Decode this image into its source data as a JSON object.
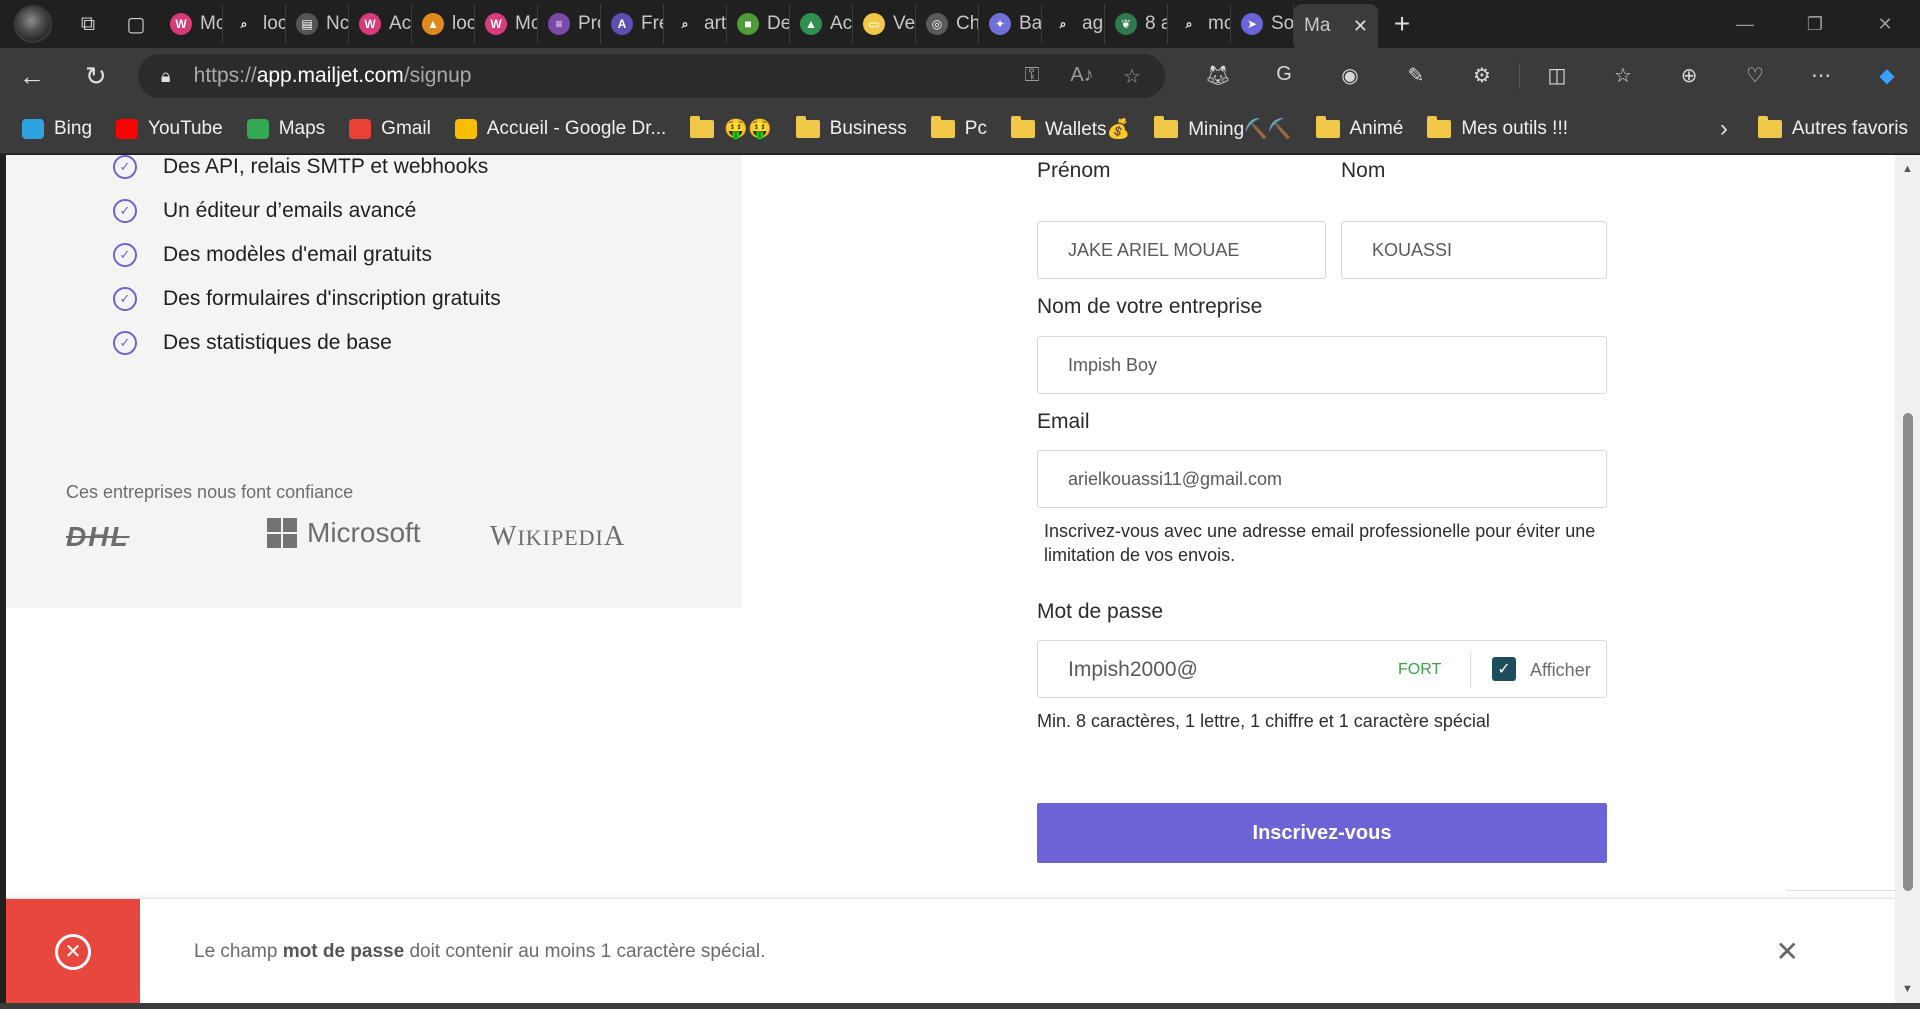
{
  "browser": {
    "tabs": [
      {
        "label": "Mc",
        "color": "#d83b7a",
        "glyph": "W"
      },
      {
        "label": "loc",
        "color": "#202020",
        "glyph": "⌕"
      },
      {
        "label": "Nc",
        "color": "#555555",
        "glyph": "▤"
      },
      {
        "label": "Ac",
        "color": "#d83b7a",
        "glyph": "W"
      },
      {
        "label": "loc",
        "color": "#e08a1e",
        "glyph": "▲"
      },
      {
        "label": "Mc",
        "color": "#d83b7a",
        "glyph": "W"
      },
      {
        "label": "Pro",
        "color": "#7a4aa8",
        "glyph": "≡"
      },
      {
        "label": "Fre",
        "color": "#5b4fb3",
        "glyph": "A"
      },
      {
        "label": "art",
        "color": "#202020",
        "glyph": "⌕"
      },
      {
        "label": "De",
        "color": "#4f9b3a",
        "glyph": "■"
      },
      {
        "label": "Ac",
        "color": "#2f8f4e",
        "glyph": "▲"
      },
      {
        "label": "Ve",
        "color": "#f2c84b",
        "glyph": "▭"
      },
      {
        "label": "Ch",
        "color": "#5a5a5a",
        "glyph": "◎"
      },
      {
        "label": "Ba",
        "color": "#6f6fd8",
        "glyph": "✦"
      },
      {
        "label": "ag",
        "color": "#202020",
        "glyph": "⌕"
      },
      {
        "label": "8 a",
        "color": "#2e7a4a",
        "glyph": "❦"
      },
      {
        "label": "mo",
        "color": "#202020",
        "glyph": "⌕"
      },
      {
        "label": "So",
        "color": "#6b63d6",
        "glyph": "➤"
      }
    ],
    "active_tab": {
      "label": "Ma",
      "close": "✕"
    },
    "url_prefix": "https://",
    "url_host": "app.mailjet.com",
    "url_path": "/signup",
    "bookmarks": [
      {
        "label": "Bing",
        "icon": "bing-icon",
        "color": "#2fa3e0"
      },
      {
        "label": "YouTube",
        "icon": "youtube-icon",
        "color": "#ff0000"
      },
      {
        "label": "Maps",
        "icon": "maps-icon",
        "color": "#34a853"
      },
      {
        "label": "Gmail",
        "icon": "gmail-icon",
        "color": "#ea4335"
      },
      {
        "label": "Accueil - Google Dr...",
        "icon": "google-drive-icon",
        "color": "#fbbc04"
      },
      {
        "label": "🤑🤑",
        "icon": "folder-icon",
        "color": "#f2c84b"
      },
      {
        "label": "Business",
        "icon": "folder-icon",
        "color": "#f2c84b"
      },
      {
        "label": "Pc",
        "icon": "folder-icon",
        "color": "#f2c84b"
      },
      {
        "label": "Wallets💰",
        "icon": "folder-icon",
        "color": "#f2c84b"
      },
      {
        "label": "Mining⛏️⛏️",
        "icon": "folder-icon",
        "color": "#f2c84b"
      },
      {
        "label": "Animé",
        "icon": "folder-icon",
        "color": "#f2c84b"
      },
      {
        "label": "Mes outils !!!",
        "icon": "folder-icon",
        "color": "#f2c84b"
      }
    ],
    "other_bookmarks": "Autres favoris"
  },
  "features": [
    "Des API, relais SMTP et webhooks",
    "Un éditeur d’emails avancé",
    "Des modèles d'email gratuits",
    "Des formulaires d'inscription gratuits",
    "Des statistiques de base"
  ],
  "trust": {
    "title": "Ces entreprises nous font confiance",
    "logos": [
      "DHL",
      "Microsoft",
      "Wikipedia"
    ]
  },
  "form": {
    "first_name_label": "Prénom",
    "first_name_value": "JAKE ARIEL MOUAE",
    "last_name_label": "Nom",
    "last_name_value": "KOUASSI",
    "company_label": "Nom de votre entreprise",
    "company_value": "Impish Boy",
    "email_label": "Email",
    "email_value": "arielkouassi11@gmail.com",
    "email_hint": "Inscrivez-vous avec une adresse email professionelle pour éviter une limitation de vos envois.",
    "password_label": "Mot de passe",
    "password_value": "Impish2000@",
    "password_strength": "FORT",
    "show_password_label": "Afficher",
    "password_hint": "Min. 8 caractères, 1 lettre, 1 chiffre et 1 caractère spécial",
    "submit_label": "Inscrivez-vous"
  },
  "toast": {
    "prefix": "Le champ ",
    "field": "mot de passe",
    "suffix": " doit contenir au moins 1 caractère spécial."
  },
  "colors": {
    "accent": "#6b63d6",
    "error": "#e8473d",
    "success": "#3aa24a"
  }
}
